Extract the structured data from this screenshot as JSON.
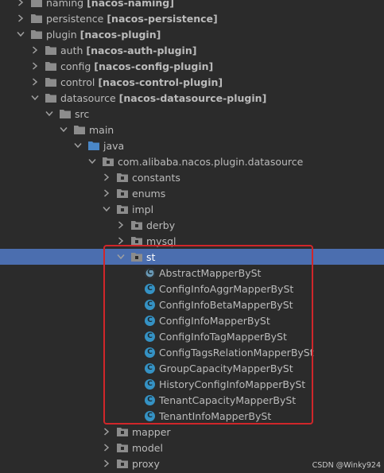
{
  "tree": [
    {
      "label": "naming",
      "module": "[nacos-naming]",
      "indent": 0,
      "expanded": false
    },
    {
      "label": "persistence",
      "module": "[nacos-persistence]",
      "indent": 0,
      "expanded": false
    },
    {
      "label": "plugin",
      "module": "[nacos-plugin]",
      "indent": 0,
      "expanded": true
    },
    {
      "label": "auth",
      "module": "[nacos-auth-plugin]",
      "indent": 1,
      "expanded": false
    },
    {
      "label": "config",
      "module": "[nacos-config-plugin]",
      "indent": 1,
      "expanded": false
    },
    {
      "label": "control",
      "module": "[nacos-control-plugin]",
      "indent": 1,
      "expanded": false
    },
    {
      "label": "datasource",
      "module": "[nacos-datasource-plugin]",
      "indent": 1,
      "expanded": true
    },
    {
      "label": "src",
      "indent": 2,
      "expanded": true
    },
    {
      "label": "main",
      "indent": 3,
      "expanded": true
    },
    {
      "label": "java",
      "indent": 4,
      "expanded": true,
      "folder_color": "#4a87c7"
    },
    {
      "label": "com.alibaba.nacos.plugin.datasource",
      "indent": 5,
      "expanded": true
    },
    {
      "label": "constants",
      "indent": 6,
      "expanded": false
    },
    {
      "label": "enums",
      "indent": 6,
      "expanded": false
    },
    {
      "label": "impl",
      "indent": 6,
      "expanded": true
    },
    {
      "label": "derby",
      "indent": 7,
      "expanded": false
    },
    {
      "label": "mysql",
      "indent": 7,
      "expanded": false
    },
    {
      "label": "st",
      "indent": 7,
      "expanded": true,
      "selected": true
    },
    {
      "label": "AbstractMapperBySt",
      "indent": 8,
      "class": true,
      "abstract": true
    },
    {
      "label": "ConfigInfoAggrMapperBySt",
      "indent": 8,
      "class": true
    },
    {
      "label": "ConfigInfoBetaMapperBySt",
      "indent": 8,
      "class": true
    },
    {
      "label": "ConfigInfoMapperBySt",
      "indent": 8,
      "class": true
    },
    {
      "label": "ConfigInfoTagMapperBySt",
      "indent": 8,
      "class": true
    },
    {
      "label": "ConfigTagsRelationMapperBySt",
      "indent": 8,
      "class": true
    },
    {
      "label": "GroupCapacityMapperBySt",
      "indent": 8,
      "class": true
    },
    {
      "label": "HistoryConfigInfoMapperBySt",
      "indent": 8,
      "class": true
    },
    {
      "label": "TenantCapacityMapperBySt",
      "indent": 8,
      "class": true
    },
    {
      "label": "TenantInfoMapperBySt",
      "indent": 8,
      "class": true
    },
    {
      "label": "mapper",
      "indent": 6,
      "expanded": false
    },
    {
      "label": "model",
      "indent": 6,
      "expanded": false
    },
    {
      "label": "proxy",
      "indent": 6,
      "expanded": false
    }
  ],
  "class_icon_letter": "C",
  "colors": {
    "background": "#2b2b2b",
    "selection": "#4b6eaf",
    "folder": "#8c8c8c",
    "class_icon": "#3592c4",
    "highlight_border": "#d0262a"
  },
  "watermark": "CSDN @Winky924"
}
